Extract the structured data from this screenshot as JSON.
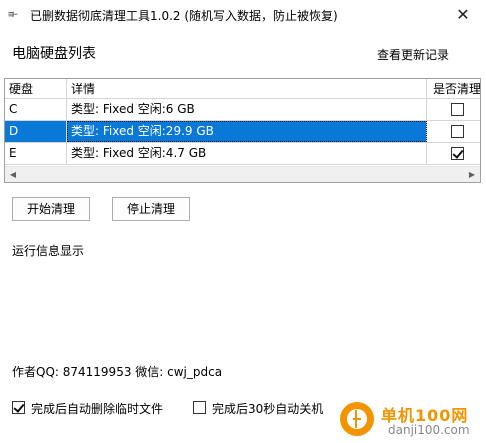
{
  "window": {
    "title": "已删数据彻底清理工具1.0.2 (随机写入数据，防止被恢复)",
    "close_glyph": "✕"
  },
  "header": {
    "section_title": "电脑硬盘列表",
    "changelog_link": "查看更新记录"
  },
  "disk_grid": {
    "columns": [
      "硬盘",
      "详情",
      "是否清理"
    ],
    "rows": [
      {
        "disk": "C",
        "details": "类型: Fixed 空闲:6 GB",
        "clean": false,
        "selected": false
      },
      {
        "disk": "D",
        "details": "类型: Fixed 空闲:29.9 GB",
        "clean": false,
        "selected": true
      },
      {
        "disk": "E",
        "details": "类型: Fixed 空闲:4.7 GB",
        "clean": true,
        "selected": false
      }
    ]
  },
  "actions": {
    "start_label": "开始清理",
    "stop_label": "停止清理"
  },
  "log": {
    "label": "运行信息显示"
  },
  "author": {
    "text": "作者QQ: 874119953  微信: cwj_pdca"
  },
  "options": {
    "delete_temp_label": "完成后自动删除临时文件",
    "delete_temp_checked": true,
    "shutdown_label": "完成后30秒自动关机",
    "shutdown_checked": false
  },
  "watermark": {
    "name": "单机100网",
    "url": "danji100.com"
  },
  "colors": {
    "selection": "#0a78d7",
    "watermark_orange": "#f29400"
  }
}
